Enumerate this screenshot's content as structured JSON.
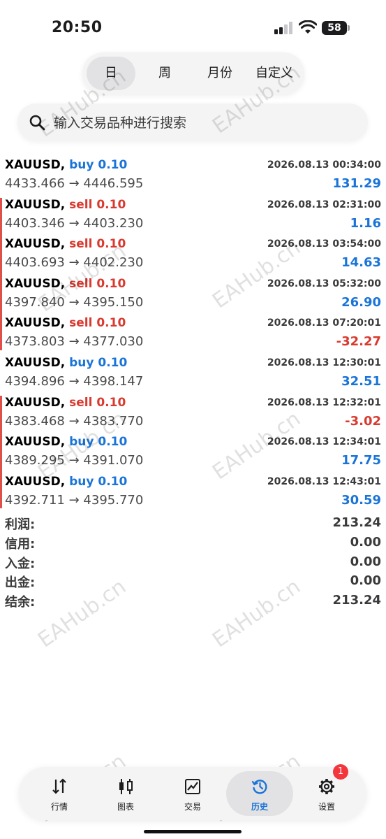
{
  "status_bar": {
    "time": "20:50",
    "battery": "58"
  },
  "period_tabs": [
    {
      "label": "日",
      "active": true
    },
    {
      "label": "周",
      "active": false
    },
    {
      "label": "月份",
      "active": false
    },
    {
      "label": "自定义",
      "active": false
    }
  ],
  "search": {
    "placeholder": "输入交易品种进行搜索"
  },
  "deals": [
    {
      "symbol": "XAUUSD,",
      "side": "buy",
      "volume": "0.10",
      "time": "2026.08.13 00:34:00",
      "prices": "4433.466 → 4446.595",
      "profit": "131.29"
    },
    {
      "symbol": "XAUUSD,",
      "side": "sell",
      "volume": "0.10",
      "time": "2026.08.13 02:31:00",
      "prices": "4403.346 → 4403.230",
      "profit": "1.16"
    },
    {
      "symbol": "XAUUSD,",
      "side": "sell",
      "volume": "0.10",
      "time": "2026.08.13 03:54:00",
      "prices": "4403.693 → 4402.230",
      "profit": "14.63"
    },
    {
      "symbol": "XAUUSD,",
      "side": "sell",
      "volume": "0.10",
      "time": "2026.08.13 05:32:00",
      "prices": "4397.840 → 4395.150",
      "profit": "26.90"
    },
    {
      "symbol": "XAUUSD,",
      "side": "sell",
      "volume": "0.10",
      "time": "2026.08.13 07:20:01",
      "prices": "4373.803 → 4377.030",
      "profit": "-32.27"
    },
    {
      "symbol": "XAUUSD,",
      "side": "buy",
      "volume": "0.10",
      "time": "2026.08.13 12:30:01",
      "prices": "4394.896 → 4398.147",
      "profit": "32.51"
    },
    {
      "symbol": "XAUUSD,",
      "side": "sell",
      "volume": "0.10",
      "time": "2026.08.13 12:32:01",
      "prices": "4383.468 → 4383.770",
      "profit": "-3.02"
    },
    {
      "symbol": "XAUUSD,",
      "side": "buy",
      "volume": "0.10",
      "time": "2026.08.13 12:34:01",
      "prices": "4389.295 → 4391.070",
      "profit": "17.75"
    },
    {
      "symbol": "XAUUSD,",
      "side": "buy",
      "volume": "0.10",
      "time": "2026.08.13 12:43:01",
      "prices": "4392.711 → 4395.770",
      "profit": "30.59"
    }
  ],
  "summary": [
    {
      "label": "利润:",
      "value": "213.24"
    },
    {
      "label": "信用:",
      "value": "0.00"
    },
    {
      "label": "入金:",
      "value": "0.00"
    },
    {
      "label": "出金:",
      "value": "0.00"
    },
    {
      "label": "结余:",
      "value": "213.24"
    }
  ],
  "watermark": "EAHub.cn",
  "bottom_nav": {
    "items": [
      {
        "label": "行情",
        "icon": "quotes-arrows-icon",
        "active": false
      },
      {
        "label": "图表",
        "icon": "candlestick-chart-icon",
        "active": false
      },
      {
        "label": "交易",
        "icon": "trade-chart-icon",
        "active": false
      },
      {
        "label": "历史",
        "icon": "history-clock-icon",
        "active": true
      },
      {
        "label": "设置",
        "icon": "gear-icon",
        "active": false
      }
    ],
    "settings_badge": "1"
  },
  "colors": {
    "buy": "#1a74d8",
    "sell": "#d93a2f",
    "accent": "#1a74d8",
    "badge": "#f2363c"
  }
}
